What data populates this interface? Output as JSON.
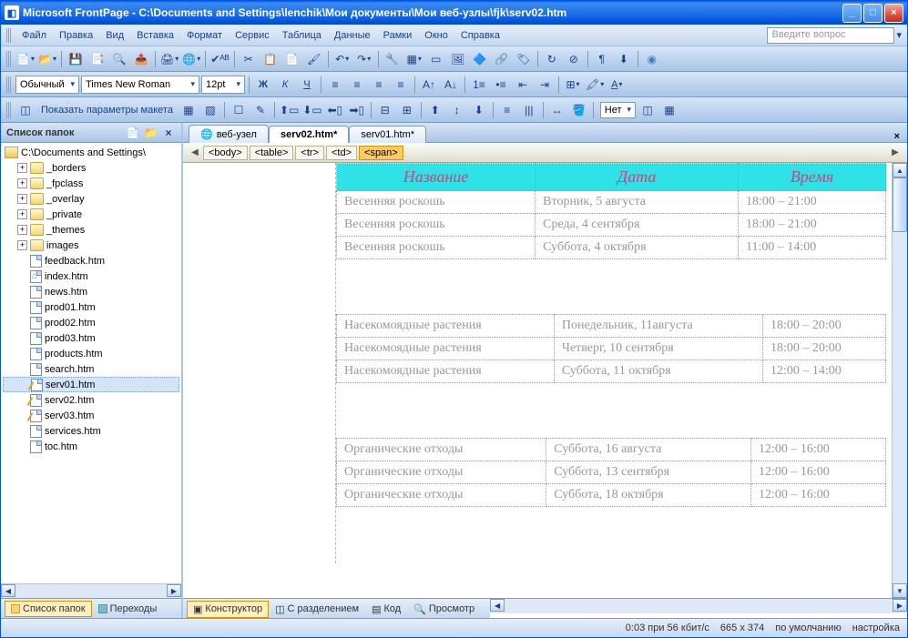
{
  "window": {
    "title": "Microsoft FrontPage - C:\\Documents and Settings\\lenchik\\Мои документы\\Мои веб-узлы\\fjk\\serv02.htm"
  },
  "menubar": {
    "items": [
      "Файл",
      "Правка",
      "Вид",
      "Вставка",
      "Формат",
      "Сервис",
      "Таблица",
      "Данные",
      "Рамки",
      "Окно",
      "Справка"
    ]
  },
  "help_placeholder": "Введите вопрос",
  "format": {
    "style": "Обычный",
    "font": "Times New Roman",
    "size": "12pt"
  },
  "layout_toolbar": {
    "label": "Показать параметры макета",
    "net_label": "Нет"
  },
  "folder_pane": {
    "title": "Список папок",
    "root": "C:\\Documents and Settings\\",
    "folders": [
      "_borders",
      "_fpclass",
      "_overlay",
      "_private",
      "_themes",
      "images"
    ],
    "files": [
      "feedback.htm",
      "index.htm",
      "news.htm",
      "prod01.htm",
      "prod02.htm",
      "prod03.htm",
      "products.htm",
      "search.htm",
      "serv01.htm",
      "serv02.htm",
      "serv03.htm",
      "services.htm",
      "toc.htm"
    ],
    "selected_file": "serv01.htm"
  },
  "bottom_left_tabs": {
    "folders": "Список папок",
    "transitions": "Переходы"
  },
  "doc_tabs": {
    "items": [
      "веб-узел",
      "serv02.htm*",
      "serv01.htm*"
    ],
    "active": 1
  },
  "breadcrumb": [
    "<body>",
    "<table>",
    "<tr>",
    "<td>",
    "<span>"
  ],
  "view_modes": {
    "design": "Конструктор",
    "split": "С разделением",
    "code": "Код",
    "preview": "Просмотр"
  },
  "table_headers": {
    "name": "Название",
    "date": "Дата",
    "time": "Время"
  },
  "tables": [
    {
      "rows": [
        {
          "name": "Весенняя роскошь",
          "date": "Вторник, 5 августа",
          "time": "18:00 – 21:00"
        },
        {
          "name": "Весенняя роскошь",
          "date": "Среда, 4 сентября",
          "time": "18:00 – 21:00"
        },
        {
          "name": "Весенняя роскошь",
          "date": "Суббота, 4 октября",
          "time": "11:00 – 14:00"
        }
      ]
    },
    {
      "rows": [
        {
          "name": "Насекомоядные растения",
          "date": "Понедельник, 11августа",
          "time": "18:00 – 20:00"
        },
        {
          "name": "Насекомоядные растения",
          "date": "Четверг, 10 сентября",
          "time": "18:00 – 20:00"
        },
        {
          "name": "Насекомоядные растения",
          "date": "Суббота, 11 октября",
          "time": "12:00 – 14:00"
        }
      ]
    },
    {
      "rows": [
        {
          "name": "Органические отходы",
          "date": "Суббота, 16 августа",
          "time": "12:00 – 16:00"
        },
        {
          "name": "Органические отходы",
          "date": "Суббота, 13 сентября",
          "time": "12:00 – 16:00"
        },
        {
          "name": "Органические отходы",
          "date": "Суббота, 18 октября",
          "time": "12:00 – 16:00"
        }
      ]
    }
  ],
  "statusbar": {
    "speed": "0:03 при 56 кбит/с",
    "size": "665 x 374",
    "default": "по умолчанию",
    "settings": "настройка"
  }
}
